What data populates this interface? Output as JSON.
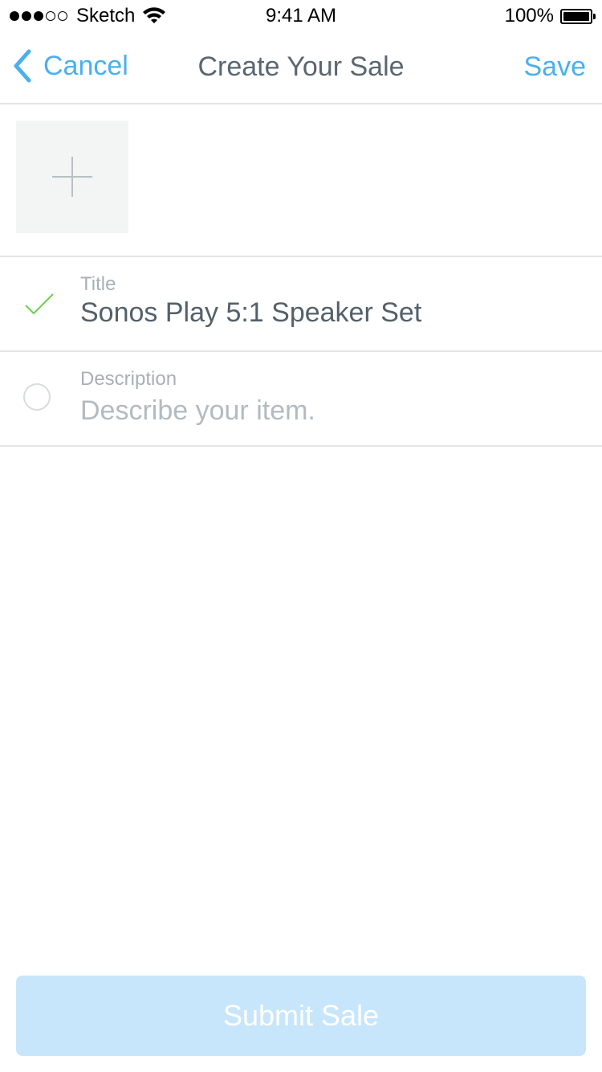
{
  "status_bar": {
    "carrier": "Sketch",
    "time": "9:41 AM",
    "battery_percent": "100%",
    "signal_bars_filled": 3,
    "signal_bars_total": 5
  },
  "nav": {
    "back_label": "Cancel",
    "title": "Create Your Sale",
    "save_label": "Save",
    "accent_color": "#4bb0ee"
  },
  "photo": {
    "add_icon": "plus-icon"
  },
  "form": {
    "title": {
      "label": "Title",
      "value": "Sonos Play 5:1 Speaker Set",
      "status_icon": "checkmark-icon",
      "status_color": "#6ad04b"
    },
    "description": {
      "label": "Description",
      "placeholder": "Describe your item.",
      "status_icon": "empty-circle-icon"
    }
  },
  "submit": {
    "label": "Submit Sale",
    "enabled": false
  }
}
